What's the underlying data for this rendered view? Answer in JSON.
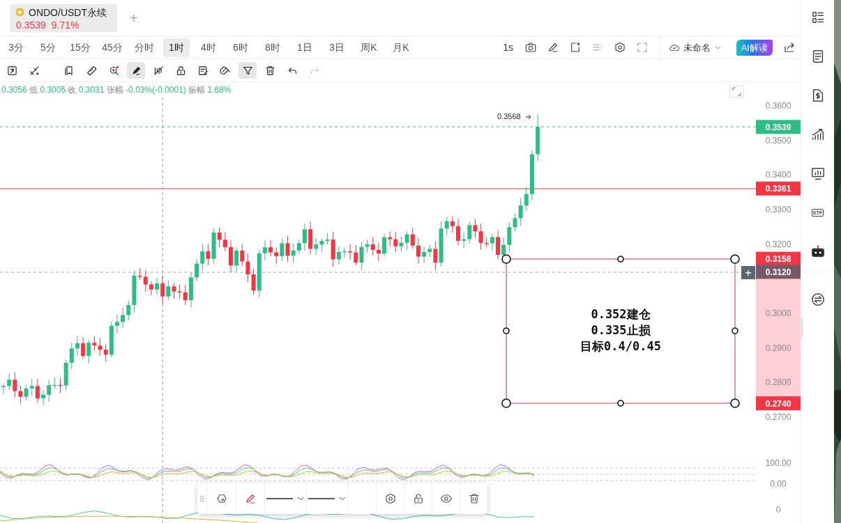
{
  "tabs": [
    {
      "symbol": "ONDO/USDT永续",
      "price": "0.3539",
      "change": "9.71%",
      "selected": true
    }
  ],
  "add_tab": "+",
  "intervals": [
    {
      "label": "3分",
      "selected": false
    },
    {
      "label": "5分",
      "selected": false
    },
    {
      "label": "15分",
      "selected": false
    },
    {
      "label": "45分",
      "selected": false
    },
    {
      "label": "分时",
      "selected": false
    },
    {
      "label": "1时",
      "selected": true
    },
    {
      "label": "4时",
      "selected": false
    },
    {
      "label": "6时",
      "selected": false
    },
    {
      "label": "8时",
      "selected": false
    },
    {
      "label": "1日",
      "selected": false
    },
    {
      "label": "3日",
      "selected": false
    },
    {
      "label": "周K",
      "selected": false
    },
    {
      "label": "月K",
      "selected": false
    }
  ],
  "chart_tools": {
    "refresh_rate": "1s",
    "layout_name": "未命名",
    "ai_button": "AI解读"
  },
  "drawing_tools": [
    {
      "kind": "replay",
      "active": false,
      "disabled": false
    },
    {
      "kind": "lines",
      "active": false,
      "disabled": false
    },
    {
      "kind": "bookmark",
      "active": false,
      "disabled": false
    },
    {
      "kind": "ruler",
      "active": false,
      "disabled": false
    },
    {
      "kind": "zoom",
      "active": false,
      "disabled": false
    },
    {
      "kind": "brush",
      "active": true,
      "disabled": false
    },
    {
      "kind": "hide",
      "active": false,
      "disabled": false
    },
    {
      "kind": "lock",
      "active": false,
      "disabled": false
    },
    {
      "kind": "note",
      "active": false,
      "disabled": false
    },
    {
      "kind": "magnet",
      "active": false,
      "disabled": false
    },
    {
      "kind": "filter",
      "active": true,
      "disabled": false
    },
    {
      "kind": "trash",
      "active": false,
      "disabled": false
    },
    {
      "kind": "undo",
      "active": false,
      "disabled": false
    },
    {
      "kind": "redo",
      "active": false,
      "disabled": true
    }
  ],
  "ohlc": [
    {
      "value": "0.3056"
    },
    {
      "label": "低",
      "value": "0.3005"
    },
    {
      "label": "收",
      "value": "0.3031"
    },
    {
      "label": "张幅",
      "value": "-0.03%(-0.0001)"
    },
    {
      "label": "振幅",
      "value": "1.68%"
    }
  ],
  "chart": {
    "high_marker": "0.3568",
    "price_ticks": [
      "0.3600",
      "0.3500",
      "0.3400",
      "0.3300",
      "0.3200",
      "0.3000",
      "0.2900",
      "0.2800",
      "0.2700"
    ],
    "price_tags": [
      {
        "value": "0.3539",
        "color": "#2ebd85"
      },
      {
        "value": "0.3361",
        "color": "#f23645"
      },
      {
        "value": "0.3158",
        "color": "#f23645"
      },
      {
        "value": "0.3120",
        "color": "#735a66"
      },
      {
        "value": "0.2740",
        "color": "#f23645"
      }
    ],
    "crosshair_add": "+",
    "note_lines": [
      "0.352建仓",
      "0.335止损",
      "目标0.4/0.45"
    ]
  },
  "indicator_ticks": [
    "100.00",
    "0.00",
    "0"
  ],
  "sidebar": [
    {
      "kind": "list"
    },
    {
      "kind": "document"
    },
    {
      "kind": "dollar"
    },
    {
      "kind": "growth"
    },
    {
      "kind": "monitor"
    },
    {
      "kind": "etf",
      "label": "ETF"
    },
    {
      "kind": "robot"
    },
    {
      "kind": "swap"
    }
  ]
}
